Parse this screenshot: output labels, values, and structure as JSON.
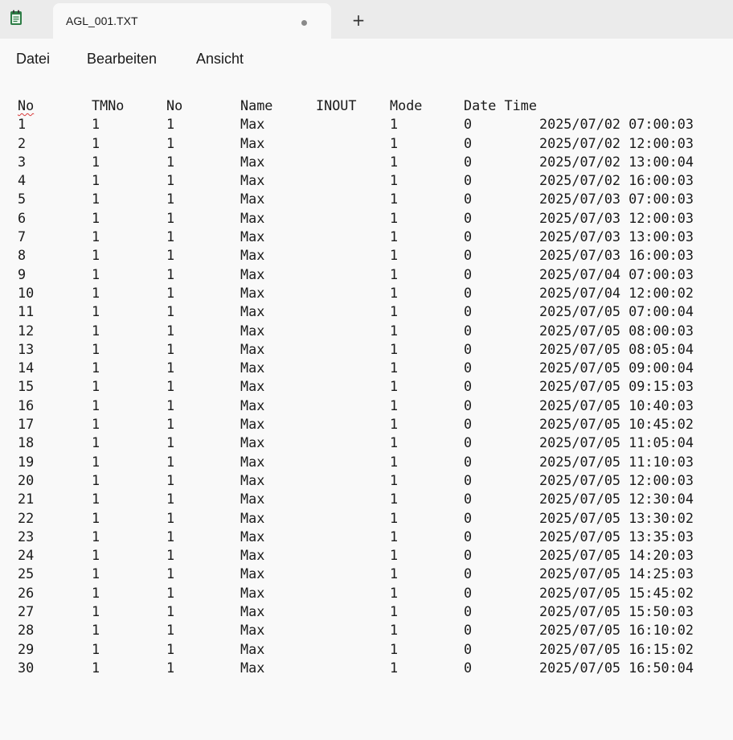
{
  "window": {
    "tab_title": "AGL_001.TXT",
    "new_tab_label": "+"
  },
  "menu": {
    "items": [
      "Datei",
      "Bearbeiten",
      "Ansicht"
    ]
  },
  "file": {
    "header": [
      "No",
      "TMNo",
      "No",
      "Name",
      "INOUT",
      "Mode",
      "Date Time",
      ""
    ],
    "rows": [
      [
        "1",
        "1",
        "1",
        "Max",
        "",
        "1",
        "0",
        "2025/07/02 07:00:03"
      ],
      [
        "2",
        "1",
        "1",
        "Max",
        "",
        "1",
        "0",
        "2025/07/02 12:00:03"
      ],
      [
        "3",
        "1",
        "1",
        "Max",
        "",
        "1",
        "0",
        "2025/07/02 13:00:04"
      ],
      [
        "4",
        "1",
        "1",
        "Max",
        "",
        "1",
        "0",
        "2025/07/02 16:00:03"
      ],
      [
        "5",
        "1",
        "1",
        "Max",
        "",
        "1",
        "0",
        "2025/07/03 07:00:03"
      ],
      [
        "6",
        "1",
        "1",
        "Max",
        "",
        "1",
        "0",
        "2025/07/03 12:00:03"
      ],
      [
        "7",
        "1",
        "1",
        "Max",
        "",
        "1",
        "0",
        "2025/07/03 13:00:03"
      ],
      [
        "8",
        "1",
        "1",
        "Max",
        "",
        "1",
        "0",
        "2025/07/03 16:00:03"
      ],
      [
        "9",
        "1",
        "1",
        "Max",
        "",
        "1",
        "0",
        "2025/07/04 07:00:03"
      ],
      [
        "10",
        "1",
        "1",
        "Max",
        "",
        "1",
        "0",
        "2025/07/04 12:00:02"
      ],
      [
        "11",
        "1",
        "1",
        "Max",
        "",
        "1",
        "0",
        "2025/07/05 07:00:04"
      ],
      [
        "12",
        "1",
        "1",
        "Max",
        "",
        "1",
        "0",
        "2025/07/05 08:00:03"
      ],
      [
        "13",
        "1",
        "1",
        "Max",
        "",
        "1",
        "0",
        "2025/07/05 08:05:04"
      ],
      [
        "14",
        "1",
        "1",
        "Max",
        "",
        "1",
        "0",
        "2025/07/05 09:00:04"
      ],
      [
        "15",
        "1",
        "1",
        "Max",
        "",
        "1",
        "0",
        "2025/07/05 09:15:03"
      ],
      [
        "16",
        "1",
        "1",
        "Max",
        "",
        "1",
        "0",
        "2025/07/05 10:40:03"
      ],
      [
        "17",
        "1",
        "1",
        "Max",
        "",
        "1",
        "0",
        "2025/07/05 10:45:02"
      ],
      [
        "18",
        "1",
        "1",
        "Max",
        "",
        "1",
        "0",
        "2025/07/05 11:05:04"
      ],
      [
        "19",
        "1",
        "1",
        "Max",
        "",
        "1",
        "0",
        "2025/07/05 11:10:03"
      ],
      [
        "20",
        "1",
        "1",
        "Max",
        "",
        "1",
        "0",
        "2025/07/05 12:00:03"
      ],
      [
        "21",
        "1",
        "1",
        "Max",
        "",
        "1",
        "0",
        "2025/07/05 12:30:04"
      ],
      [
        "22",
        "1",
        "1",
        "Max",
        "",
        "1",
        "0",
        "2025/07/05 13:30:02"
      ],
      [
        "23",
        "1",
        "1",
        "Max",
        "",
        "1",
        "0",
        "2025/07/05 13:35:03"
      ],
      [
        "24",
        "1",
        "1",
        "Max",
        "",
        "1",
        "0",
        "2025/07/05 14:20:03"
      ],
      [
        "25",
        "1",
        "1",
        "Max",
        "",
        "1",
        "0",
        "2025/07/05 14:25:03"
      ],
      [
        "26",
        "1",
        "1",
        "Max",
        "",
        "1",
        "0",
        "2025/07/05 15:45:02"
      ],
      [
        "27",
        "1",
        "1",
        "Max",
        "",
        "1",
        "0",
        "2025/07/05 15:50:03"
      ],
      [
        "28",
        "1",
        "1",
        "Max",
        "",
        "1",
        "0",
        "2025/07/05 16:10:02"
      ],
      [
        "29",
        "1",
        "1",
        "Max",
        "",
        "1",
        "0",
        "2025/07/05 16:15:02"
      ],
      [
        "30",
        "1",
        "1",
        "Max",
        "",
        "1",
        "0",
        "2025/07/05 16:50:04"
      ]
    ]
  },
  "colors": {
    "titlebar": "#ebebeb",
    "background": "#f9f9f9",
    "text": "#1a1a1a",
    "app_icon": "#2d7d46",
    "spellcheck": "#d83b3b"
  },
  "icons": {
    "app": "notepad-icon",
    "modified": "unsaved-dot-icon"
  }
}
